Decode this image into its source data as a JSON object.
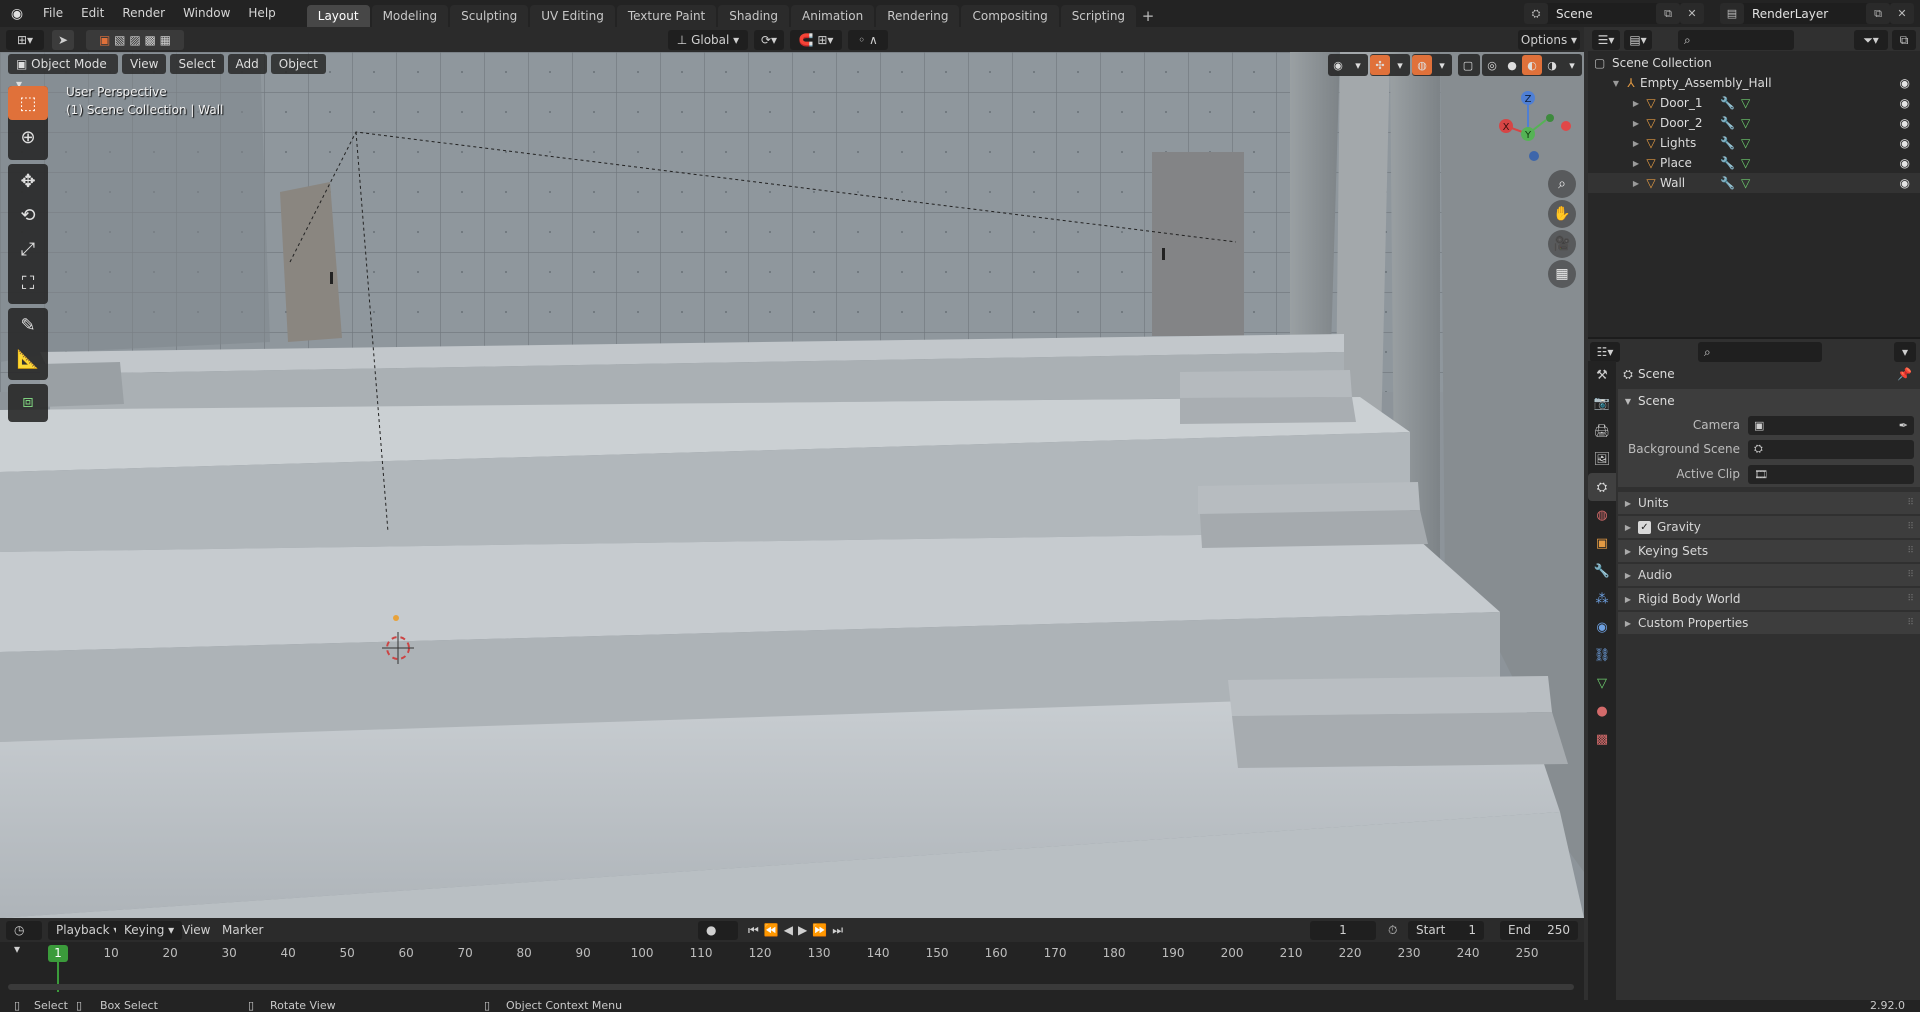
{
  "topbar": {
    "menus": [
      "File",
      "Edit",
      "Render",
      "Window",
      "Help"
    ],
    "workspaces": [
      "Layout",
      "Modeling",
      "Sculpting",
      "UV Editing",
      "Texture Paint",
      "Shading",
      "Animation",
      "Rendering",
      "Compositing",
      "Scripting"
    ],
    "active_workspace": "Layout",
    "scene_name": "Scene",
    "view_layer": "RenderLayer"
  },
  "toolheader": {
    "transform_orientation": "Global",
    "options_label": "Options"
  },
  "viewport": {
    "mode": "Object Mode",
    "menus": [
      "View",
      "Select",
      "Add",
      "Object"
    ],
    "perspective_label": "User Perspective",
    "collection_label": "(1) Scene Collection | Wall",
    "gizmo_axes": [
      "X",
      "Y",
      "Z"
    ]
  },
  "outliner": {
    "root": "Scene Collection",
    "collection": "Empty_Assembly_Hall",
    "objects": [
      "Door_1",
      "Door_2",
      "Lights",
      "Place",
      "Wall"
    ]
  },
  "properties": {
    "context": "Scene",
    "section": "Scene",
    "fields": [
      {
        "label": "Camera",
        "value": ""
      },
      {
        "label": "Background Scene",
        "value": ""
      },
      {
        "label": "Active Clip",
        "value": ""
      }
    ],
    "panels": [
      "Units",
      "Gravity",
      "Keying Sets",
      "Audio",
      "Rigid Body World",
      "Custom Properties"
    ],
    "gravity_enabled": true
  },
  "timeline": {
    "menus": [
      "Playback",
      "Keying",
      "View",
      "Marker"
    ],
    "current_frame": "1",
    "start_label": "Start",
    "start_frame": "1",
    "end_label": "End",
    "end_frame": "250",
    "ticks": [
      "10",
      "20",
      "30",
      "40",
      "50",
      "60",
      "70",
      "80",
      "90",
      "100",
      "110",
      "120",
      "130",
      "140",
      "150",
      "160",
      "170",
      "180",
      "190",
      "200",
      "210",
      "220",
      "230",
      "240",
      "250"
    ]
  },
  "statusbar": {
    "select": "Select",
    "box_select": "Box Select",
    "rotate_view": "Rotate View",
    "context_menu": "Object Context Menu",
    "version": "2.92.0"
  },
  "colors": {
    "accent": "#e0713a",
    "frame_cursor": "#3b9b3b",
    "object_icon": "#e39a43"
  }
}
